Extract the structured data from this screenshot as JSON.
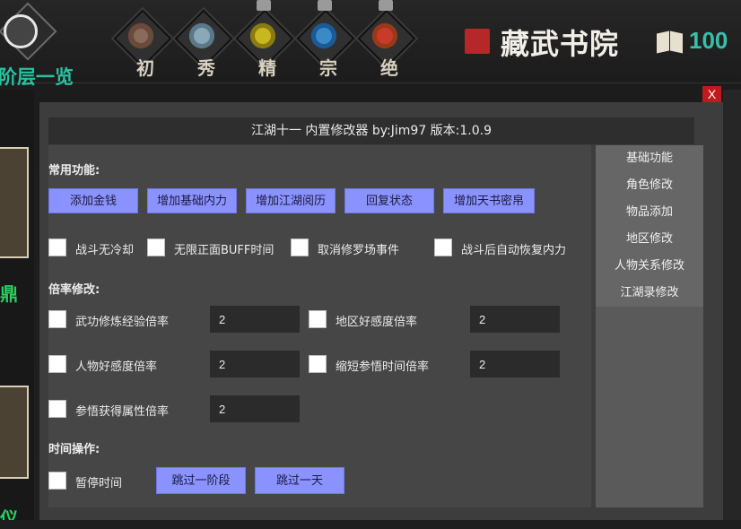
{
  "game": {
    "stage_tabs": [
      {
        "name": "初",
        "locked": false,
        "icon": "round-brown-emblem-icon"
      },
      {
        "name": "秀",
        "locked": false,
        "icon": "round-gray-emblem-icon"
      },
      {
        "name": "精",
        "locked": true,
        "icon": "gold-serpent-emblem-icon"
      },
      {
        "name": "宗",
        "locked": true,
        "icon": "blue-dragon-emblem-icon"
      },
      {
        "name": "绝",
        "locked": true,
        "icon": "red-beast-emblem-icon"
      }
    ],
    "location_title": "藏武书院",
    "book_count": "100",
    "stage_overview_label": "阶层一览",
    "left_partial_text_1": "鼎",
    "left_partial_text_2": "仪"
  },
  "trainer": {
    "title": "江湖十一 内置修改器 by:Jim97 版本:1.0.9",
    "close_label": "X",
    "common_section": "常用功能:",
    "common_buttons": [
      "添加金钱",
      "增加基础内力",
      "增加江湖阅历",
      "回复状态",
      "增加天书密帛"
    ],
    "common_toggles": [
      "战斗无冷却",
      "无限正面BUFF时间",
      "取消修罗场事件",
      "战斗后自动恢复内力"
    ],
    "multiplier_section": "倍率修改:",
    "multipliers": [
      {
        "label": "武功修炼经验倍率",
        "value": "2"
      },
      {
        "label": "地区好感度倍率",
        "value": "2"
      },
      {
        "label": "人物好感度倍率",
        "value": "2"
      },
      {
        "label": "缩短参悟时间倍率",
        "value": "2"
      },
      {
        "label": "参悟获得属性倍率",
        "value": "2"
      }
    ],
    "time_section": "时间操作:",
    "pause_label": "暂停时间",
    "time_buttons": [
      "跳过一阶段",
      "跳过一天"
    ],
    "tabs": [
      "基础功能",
      "角色修改",
      "物品添加",
      "地区修改",
      "人物关系修改",
      "江湖录修改"
    ],
    "colors": {
      "button": "#8a92ff",
      "close": "#c2191c",
      "panel": "#464646"
    }
  }
}
